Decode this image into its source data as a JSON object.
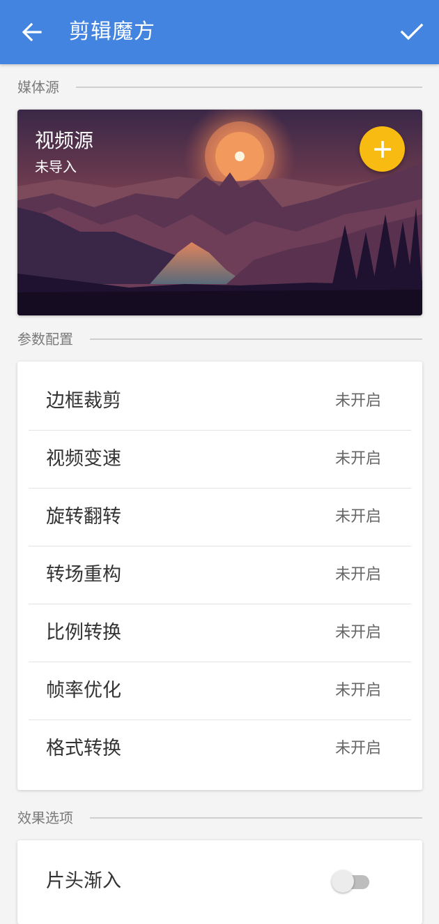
{
  "appbar": {
    "title": "剪辑魔方",
    "back_icon": "arrow-left-icon",
    "confirm_icon": "check-icon",
    "color": "#4284e0"
  },
  "media_section": {
    "header": "媒体源",
    "card": {
      "title": "视频源",
      "status": "未导入",
      "add_icon": "plus-icon",
      "fab_color": "#f8bb11"
    }
  },
  "params_section": {
    "header": "参数配置",
    "items": [
      {
        "label": "边框裁剪",
        "value": "未开启"
      },
      {
        "label": "视频变速",
        "value": "未开启"
      },
      {
        "label": "旋转翻转",
        "value": "未开启"
      },
      {
        "label": "转场重构",
        "value": "未开启"
      },
      {
        "label": "比例转换",
        "value": "未开启"
      },
      {
        "label": "帧率优化",
        "value": "未开启"
      },
      {
        "label": "格式转换",
        "value": "未开启"
      }
    ]
  },
  "effects_section": {
    "header": "效果选项",
    "items": [
      {
        "label": "片头渐入",
        "enabled": false
      }
    ]
  }
}
